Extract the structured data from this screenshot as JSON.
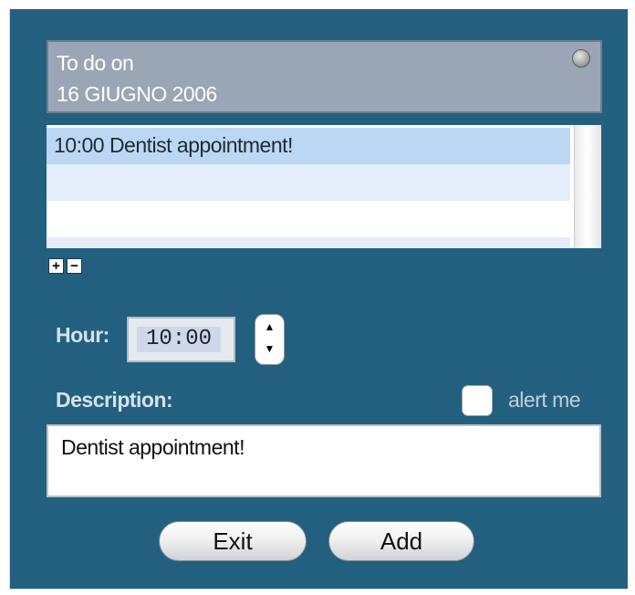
{
  "header": {
    "title_line1": "To do on",
    "title_line2": "16 GIUGNO 2006"
  },
  "list": {
    "items": [
      "10:00 Dentist appointment!"
    ]
  },
  "controls": {
    "add_icon": "+",
    "remove_icon": "−"
  },
  "form": {
    "hour_label": "Hour:",
    "hour_value": "10:00",
    "stepper_up": "▲",
    "stepper_down": "▼",
    "description_label": "Description:",
    "alert_label": "alert me",
    "alert_checked": false,
    "description_value": "Dentist appointment!"
  },
  "buttons": {
    "exit_label": "Exit",
    "add_label": "Add"
  },
  "colors": {
    "panel_bg": "#23607f",
    "header_bg": "#9aa6b5",
    "selected_row": "#bcd7f3",
    "alt_row": "#e4eefb"
  }
}
